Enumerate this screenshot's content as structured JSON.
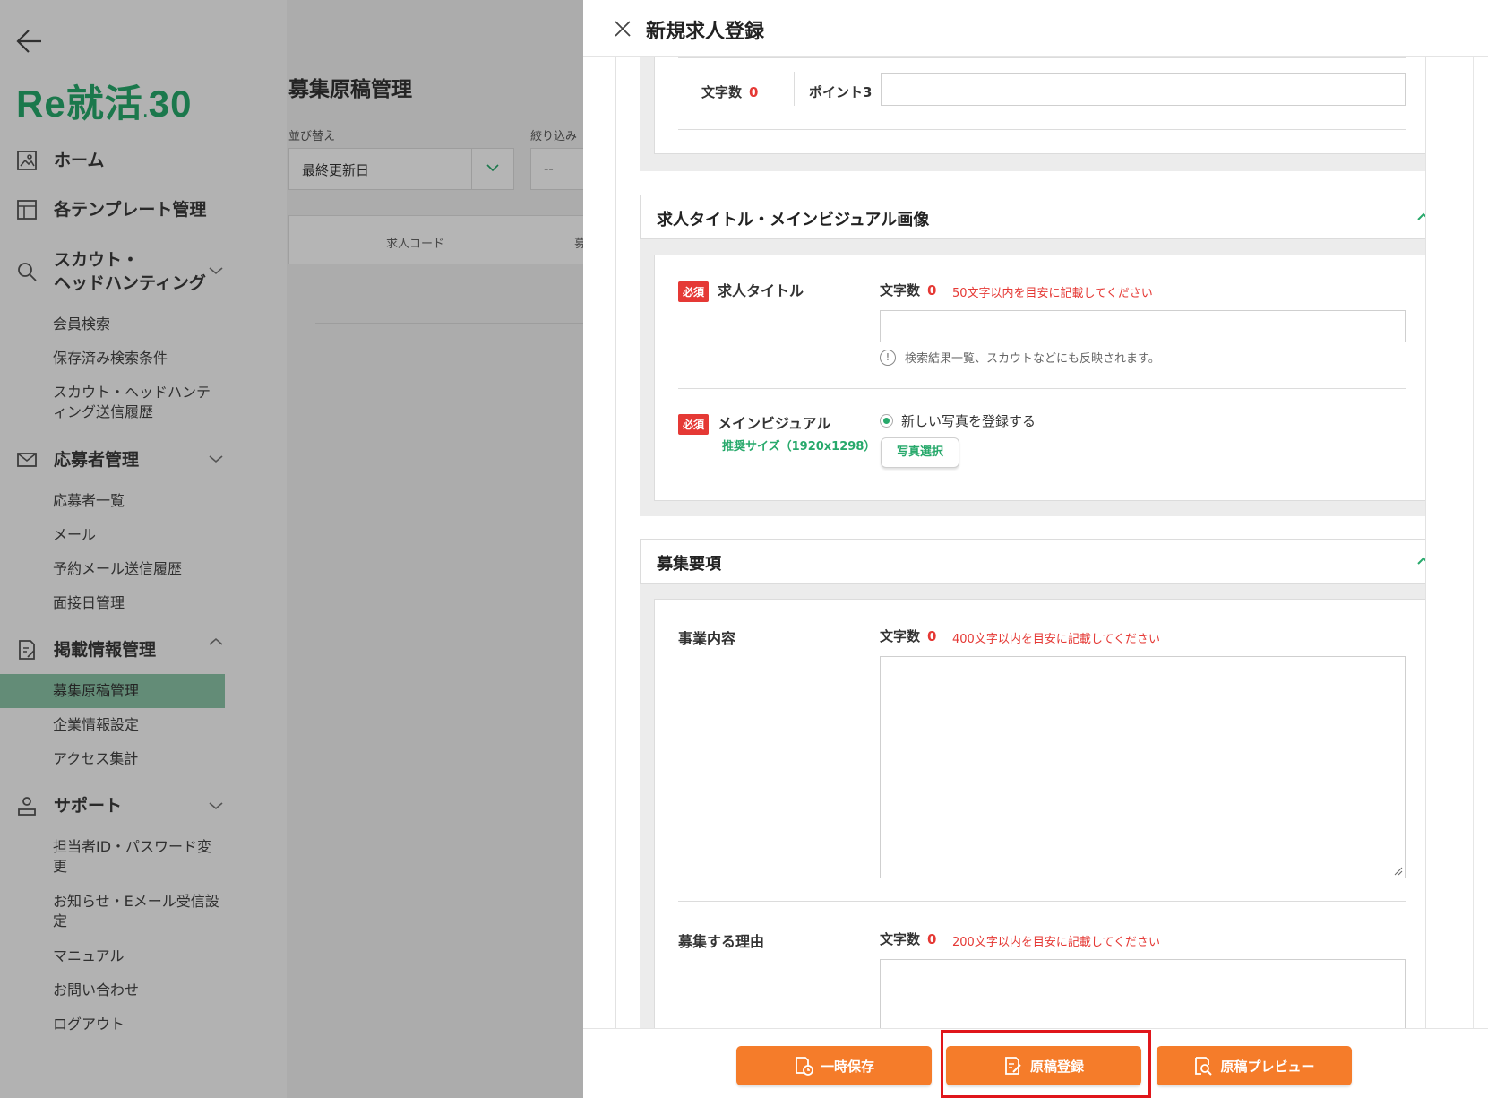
{
  "sidebar": {
    "logo_text": "Re就活",
    "logo_suffix": "30",
    "nav": [
      {
        "label": "ホーム"
      },
      {
        "label": "各テンプレート管理"
      },
      {
        "label": "スカウト・\nヘッドハンティング"
      },
      {
        "label": "応募者管理"
      },
      {
        "label": "掲載情報管理"
      },
      {
        "label": "サポート"
      }
    ],
    "scout_sub": [
      "会員検索",
      "保存済み検索条件",
      "スカウト・ヘッドハンティング送信履歴"
    ],
    "applicant_sub": [
      "応募者一覧",
      "メール",
      "予約メール送信履歴",
      "面接日管理"
    ],
    "posting_sub": [
      "募集原稿管理",
      "企業情報設定",
      "アクセス集計"
    ],
    "support_sub": [
      "担当者ID・パスワード変更",
      "お知らせ・Eメール受信設定",
      "マニュアル",
      "お問い合わせ",
      "ログアウト"
    ]
  },
  "main": {
    "title": "募集原稿管理",
    "sort_label": "並び替え",
    "sort_value": "最終更新日",
    "filter_label": "絞り込み",
    "filter_value": "--",
    "table_col1": "求人コード",
    "table_col2": "募"
  },
  "drawer": {
    "title": "新規求人登録",
    "top_row": {
      "count_label": "文字数",
      "count_value": "0",
      "point_label": "ポイント3"
    },
    "section_title": {
      "heading": "求人タイトル・メインビジュアル画像",
      "req": "必須",
      "job_title_label": "求人タイトル",
      "count_label": "文字数",
      "count_value": "0",
      "hint": "50文字以内を目安に記載してください",
      "info": "検索結果一覧、スカウトなどにも反映されます。",
      "visual_label": "メインビジュアル",
      "visual_note": "推奨サイズ（1920x1298）",
      "radio_label": "新しい写真を登録する",
      "photo_button": "写真選択"
    },
    "section_recruit": {
      "heading": "募集要項",
      "business_label": "事業内容",
      "business_count_label": "文字数",
      "business_count": "0",
      "business_hint": "400文字以内を目安に記載してください",
      "reason_label": "募集する理由",
      "reason_count_label": "文字数",
      "reason_count": "0",
      "reason_hint": "200文字以内を目安に記載してください"
    },
    "footer": {
      "save_temp": "一時保存",
      "register": "原稿登録",
      "preview": "原稿プレビュー"
    }
  },
  "colors": {
    "accent_green": "#27a96b",
    "button_orange": "#f57c2a",
    "required_red": "#e53935",
    "highlight_red": "#e0161b"
  }
}
